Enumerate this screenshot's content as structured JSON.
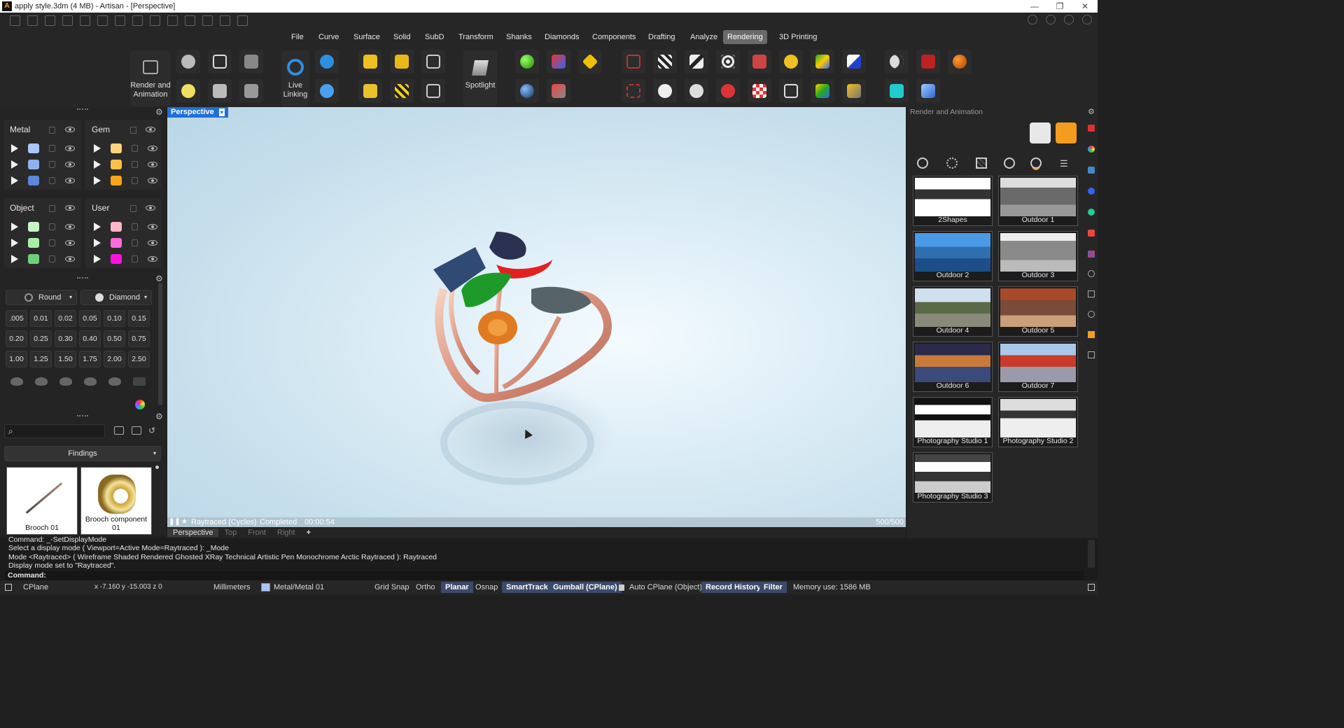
{
  "window": {
    "title": "apply style.3dm (4 MB) - Artisan - [Perspective]",
    "min": "—",
    "max": "❐",
    "close": "✕"
  },
  "menu": [
    "File",
    "Curve",
    "Surface",
    "Solid",
    "SubD",
    "Transform",
    "Shanks",
    "Diamonds",
    "Components",
    "Drafting",
    "Analyze",
    "Rendering",
    "3D Printing"
  ],
  "menu_active": "Rendering",
  "ribbon": {
    "render_animation": "Render and Animation",
    "live_linking": "Live Linking",
    "spotlight": "Spotlight"
  },
  "layers": {
    "metal": {
      "title": "Metal",
      "colors": [
        "#a9c4f5",
        "#8fb2ee",
        "#5d87d9"
      ]
    },
    "gem": {
      "title": "Gem",
      "colors": [
        "#ffd27a",
        "#ffc04a",
        "#ffa41a"
      ]
    },
    "object": {
      "title": "Object",
      "colors": [
        "#c8f5c8",
        "#a9f0a6",
        "#6fce7a"
      ]
    },
    "user": {
      "title": "User",
      "colors": [
        "#ffb6c8",
        "#ff6bdd",
        "#ff10e0"
      ]
    }
  },
  "stone": {
    "cut1": "Round",
    "cut2": "Diamond"
  },
  "sizes": [
    ".005",
    "0.01",
    "0.02",
    "0.05",
    "0.10",
    "0.15",
    "0.20",
    "0.25",
    "0.30",
    "0.40",
    "0.50",
    "0.75",
    "1.00",
    "1.25",
    "1.50",
    "1.75",
    "2.00",
    "2.50"
  ],
  "library": {
    "search_placeholder": "",
    "category": "Findings",
    "items": [
      "Brooch 01",
      "Brooch component 01"
    ]
  },
  "viewport": {
    "name": "Perspective",
    "renderer": "Raytraced (Cycles)",
    "state": "Completed",
    "time": "00:00:54",
    "samples": "500/500"
  },
  "viewtabs": [
    "Perspective",
    "Top",
    "Front",
    "Right",
    "+"
  ],
  "render_panel": {
    "title": "Render and Animation",
    "environments": [
      "2Shapes",
      "Outdoor 1",
      "Outdoor 2",
      "Outdoor 3",
      "Outdoor 4",
      "Outdoor 5",
      "Outdoor 6",
      "Outdoor 7",
      "Photography Studio 1",
      "Photography Studio 2",
      "Photography Studio 3"
    ]
  },
  "command": {
    "lines": [
      "Command: _-SetDisplayMode",
      "Select a display mode ( Viewport=Active  Mode=Raytraced ): _Mode",
      "Mode <Raytraced> ( Wireframe  Shaded  Rendered  Ghosted  XRay  Technical  Artistic  Pen  Monochrome  Arctic  Raytraced ): Raytraced",
      "Display mode set to \"Raytraced\"."
    ],
    "prompt": "Command:"
  },
  "status": {
    "cplane": "CPlane",
    "coords": "x -7.160  y -15.003  z 0",
    "units": "Millimeters",
    "layer": "Metal/Metal 01",
    "grid_snap": "Grid Snap",
    "ortho": "Ortho",
    "planar": "Planar",
    "osnap": "Osnap",
    "smarttrack": "SmartTrack",
    "gumball": "Gumball (CPlane)",
    "auto_cplane": "Auto CPlane (Object)",
    "record_history": "Record History",
    "filter": "Filter",
    "memory": "Memory use: 1586 MB"
  }
}
